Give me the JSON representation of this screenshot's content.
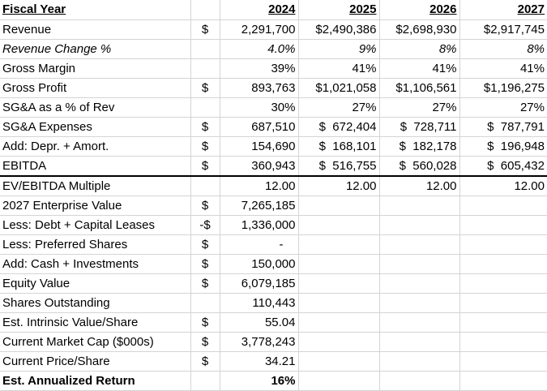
{
  "header": {
    "label": "Fiscal Year",
    "years": [
      "2024",
      "2025",
      "2026",
      "2027"
    ]
  },
  "rows": {
    "revenue": {
      "label": "Revenue",
      "cur": "$",
      "v2024": "2,291,700",
      "v2025": "$2,490,386",
      "v2026": "$2,698,930",
      "v2027": "$2,917,745"
    },
    "revenue_change": {
      "label": "Revenue Change %",
      "v2024": "4.0%",
      "v2025": "9%",
      "v2026": "8%",
      "v2027": "8%"
    },
    "gross_margin": {
      "label": "Gross Margin",
      "v2024": "39%",
      "v2025": "41%",
      "v2026": "41%",
      "v2027": "41%"
    },
    "gross_profit": {
      "label": "Gross Profit",
      "cur": "$",
      "v2024": "893,763",
      "v2025": "$1,021,058",
      "v2026": "$1,106,561",
      "v2027": "$1,196,275"
    },
    "sga_pct": {
      "label": "SG&A as a % of Rev",
      "v2024": "30%",
      "v2025": "27%",
      "v2026": "27%",
      "v2027": "27%"
    },
    "sga_exp": {
      "label": "SG&A Expenses",
      "cur": "$",
      "v2024": "687,510",
      "v2025": "$  672,404",
      "v2026": "$  728,711",
      "v2027": "$  787,791"
    },
    "depr": {
      "label": "Add: Depr. + Amort.",
      "cur": "$",
      "v2024": "154,690",
      "v2025": "$  168,101",
      "v2026": "$  182,178",
      "v2027": "$  196,948"
    },
    "ebitda": {
      "label": "EBITDA",
      "cur": "$",
      "v2024": "360,943",
      "v2025": "$  516,755",
      "v2026": "$  560,028",
      "v2027": "$  605,432"
    },
    "ev_mult": {
      "label": "EV/EBITDA Multiple",
      "v2024": "12.00",
      "v2025": "12.00",
      "v2026": "12.00",
      "v2027": "12.00"
    },
    "ev_2027": {
      "label": "2027 Enterprise Value",
      "cur": "$",
      "v2024": "7,265,185"
    },
    "debt": {
      "label": "Less: Debt + Capital Leases",
      "cur": "-$",
      "v2024": "1,336,000"
    },
    "preferred": {
      "label": "Less: Preferred Shares",
      "cur": "$",
      "v2024": "-"
    },
    "cash": {
      "label": "Add: Cash + Investments",
      "cur": "$",
      "v2024": "150,000"
    },
    "equity": {
      "label": "Equity Value",
      "cur": "$",
      "v2024": "6,079,185"
    },
    "shares": {
      "label": "Shares Outstanding",
      "v2024": "110,443"
    },
    "intrinsic": {
      "label": "Est. Intrinsic Value/Share",
      "cur": "$",
      "v2024": "55.04"
    },
    "mktcap": {
      "label": "Current Market Cap ($000s)",
      "cur": "$",
      "v2024": "3,778,243"
    },
    "price": {
      "label": "Current Price/Share",
      "cur": "$",
      "v2024": "34.21"
    },
    "return": {
      "label": "Est. Annualized Return",
      "v2024": "16%"
    }
  }
}
